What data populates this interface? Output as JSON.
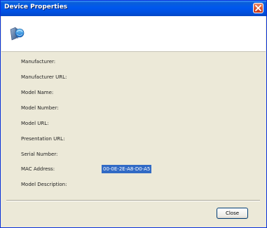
{
  "window": {
    "title": "Device Properties"
  },
  "properties": [
    {
      "label": "Manufacturer:",
      "value": ""
    },
    {
      "label": "Manufacturer URL:",
      "value": ""
    },
    {
      "label": "Model Name:",
      "value": ""
    },
    {
      "label": "Model Number:",
      "value": ""
    },
    {
      "label": "Model URL:",
      "value": ""
    },
    {
      "label": "Presentation URL:",
      "value": ""
    },
    {
      "label": "Serial Number:",
      "value": ""
    },
    {
      "label": "MAC Address:",
      "value": "00-0E-2E-A8-D0-A5"
    },
    {
      "label": "Model Description:",
      "value": ""
    }
  ],
  "footer": {
    "close_label": "Close"
  },
  "colors": {
    "titlebar": "#0058ee",
    "selection": "#316ac5",
    "dialog_bg": "#ece9d8"
  },
  "icons": {
    "title_close": "close-icon",
    "device": "network-device-icon"
  }
}
